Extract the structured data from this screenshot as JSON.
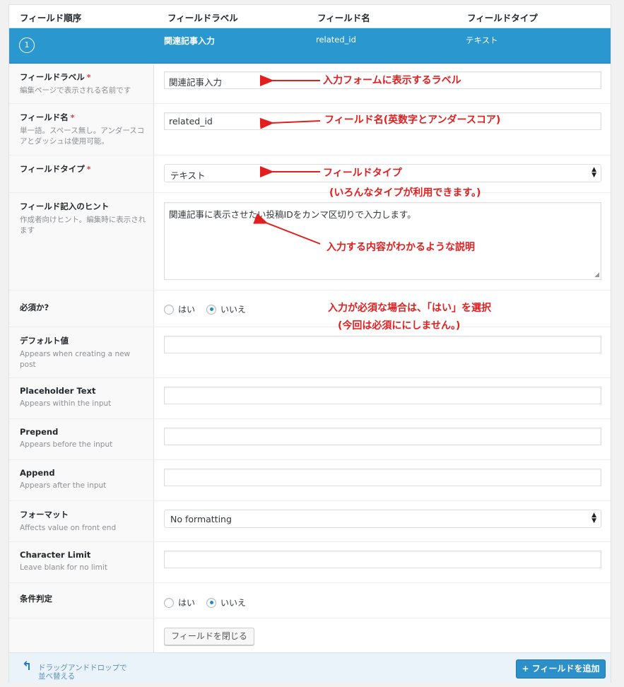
{
  "header": {
    "col_order": "フィールド順序",
    "col_label": "フィールドラベル",
    "col_name": "フィールド名",
    "col_type": "フィールドタイプ"
  },
  "field": {
    "order": "1",
    "label": "関連記事入力",
    "name": "related_id",
    "type": "テキスト"
  },
  "rows": {
    "label": {
      "title": "フィールドラベル",
      "required": "*",
      "desc": "編集ページで表示される名前です",
      "value": "関連記事入力"
    },
    "name": {
      "title": "フィールド名",
      "required": "*",
      "desc": "単一語。スペース無し。アンダースコアとダッシュは使用可能。",
      "value": "related_id"
    },
    "type": {
      "title": "フィールドタイプ",
      "required": "*",
      "value": "テキスト"
    },
    "hint": {
      "title": "フィールド記入のヒント",
      "desc": "作成者向けヒント。編集時に表示されます",
      "value": "関連記事に表示させたい投稿IDをカンマ区切りで入力します。"
    },
    "required_q": {
      "title": "必須か?",
      "yes": "はい",
      "no": "いいえ",
      "selected": "いいえ"
    },
    "default": {
      "title": "デフォルト値",
      "desc": "Appears when creating a new post",
      "value": ""
    },
    "placeholder": {
      "title": "Placeholder Text",
      "desc": "Appears within the input",
      "value": ""
    },
    "prepend": {
      "title": "Prepend",
      "desc": "Appears before the input",
      "value": ""
    },
    "append": {
      "title": "Append",
      "desc": "Appears after the input",
      "value": ""
    },
    "format": {
      "title": "フォーマット",
      "desc": "Affects value on front end",
      "value": "No formatting"
    },
    "limit": {
      "title": "Character Limit",
      "desc": "Leave blank for no limit",
      "value": ""
    },
    "conditional": {
      "title": "条件判定",
      "yes": "はい",
      "no": "いいえ",
      "selected": "いいえ"
    }
  },
  "buttons": {
    "close_field": "フィールドを閉じる",
    "add_field": "+ フィールドを追加"
  },
  "footer": {
    "drag_hint": "ドラッグアンドドロップで並べ替える"
  },
  "annotations": {
    "label_note": "入力フォームに表示するラベル",
    "name_note": "フィールド名(英数字とアンダースコア)",
    "type_note_1": "フィールドタイプ",
    "type_note_2": "(いろんなタイプが利用できます。)",
    "hint_note": "入力する内容がわかるような説明",
    "required_note_1": "入力が必須な場合は、「はい」を選択",
    "required_note_2": "(今回は必須ににしません。)"
  },
  "colors": {
    "accent": "#2a97cf",
    "annotation": "#e31e1e",
    "required_mark": "#dd3d36"
  }
}
